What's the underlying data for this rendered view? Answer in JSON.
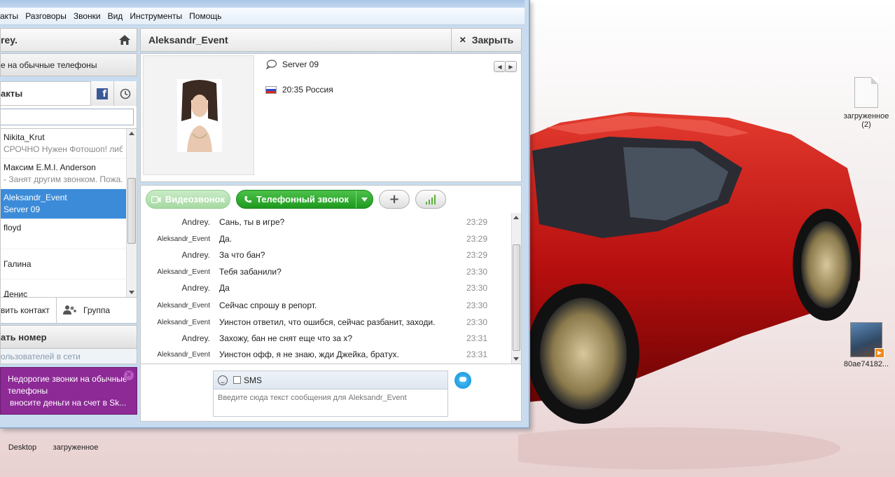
{
  "menu": [
    "акты",
    "Разговоры",
    "Звонки",
    "Вид",
    "Инструменты",
    "Помощь"
  ],
  "profile": {
    "name": "rey."
  },
  "phones_button": "е на обычные телефоны",
  "contacts": {
    "title": "акты",
    "items": [
      {
        "name": "Nikita_Krut",
        "status": "СРОЧНО Нужен Фотошоп! либ..."
      },
      {
        "name": "Максим E.M.I. Anderson",
        "status": "- Занят другим звонком. Пожа..."
      },
      {
        "name": "Aleksandr_Event",
        "status": "Server 09",
        "selected": true
      },
      {
        "name": "floyd",
        "status": ""
      },
      {
        "name": "Галина",
        "status": ""
      },
      {
        "name": "Денис",
        "status": ""
      }
    ]
  },
  "actions": {
    "add_contact": "вить контакт",
    "group": "Группа"
  },
  "dial_button": "ать номер",
  "online_count": "ользователей в сети",
  "promo": {
    "line1": "Недорогие звонки на обычные телефоны",
    "line2": "вносите деньги на счет в Sk..."
  },
  "chat": {
    "title": "Aleksandr_Event",
    "close_label": "Закрыть",
    "mood": "Server 09",
    "local_time": "20:35 Россия",
    "video_call": "Видеозвонок",
    "phone_call": "Телефонный звонок"
  },
  "messages": [
    {
      "sender": "Andrey.",
      "text": "Сань, ты в игре?",
      "time": "23:29"
    },
    {
      "sender": "Aleksandr_Event",
      "text": "Да.",
      "time": "23:29"
    },
    {
      "sender": "Andrey.",
      "text": "За что бан?",
      "time": "23:29"
    },
    {
      "sender": "Aleksandr_Event",
      "text": "Тебя забанили?",
      "time": "23:30"
    },
    {
      "sender": "Andrey.",
      "text": "Да",
      "time": "23:30"
    },
    {
      "sender": "Aleksandr_Event",
      "text": "Сейчас спрошу в репорт.",
      "time": "23:30"
    },
    {
      "sender": "Aleksandr_Event",
      "text": "Уинстон ответил, что ошибся, сейчас разбанит, заходи.",
      "time": "23:30"
    },
    {
      "sender": "Andrey.",
      "text": "Захожу, бан не снят еще что за х?",
      "time": "23:31"
    },
    {
      "sender": "Aleksandr_Event",
      "text": "Уинстон офф, я не знаю, жди Джейка, братух.",
      "time": "23:31"
    }
  ],
  "compose": {
    "sms_label": "SMS",
    "placeholder": "Введите сюда текст сообщения для Aleksandr_Event"
  },
  "desktop_icons": {
    "file_right": "загруженное (2)",
    "photo": "80ae74182...",
    "desktop": "Desktop",
    "file_bottom": "загруженное"
  },
  "colors": {
    "selected_contact": "#3b8bd9",
    "call_green": "#1e9a1e",
    "promo": "#8d2a96",
    "car_red": "#c41010"
  }
}
